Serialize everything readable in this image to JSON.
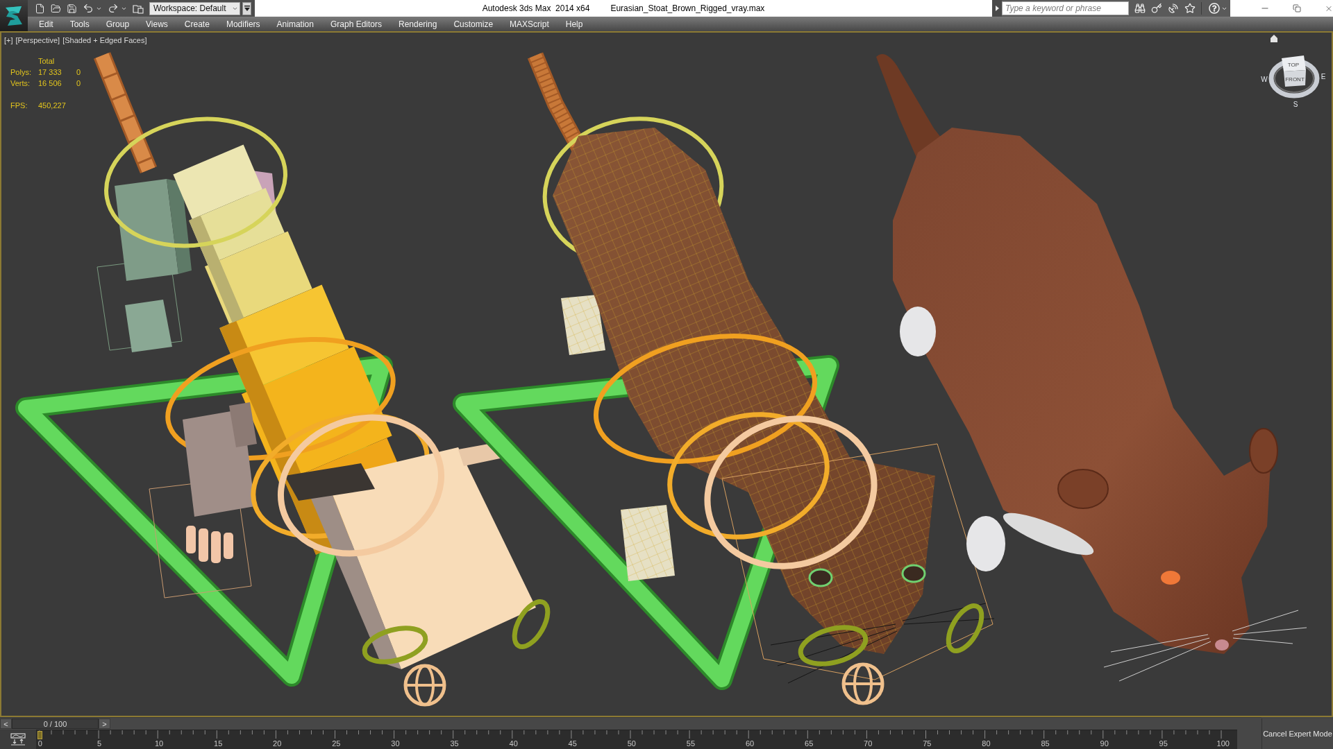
{
  "title_bar": {
    "workspace": "Workspace: Default",
    "title": "Autodesk 3ds Max  2014 x64",
    "file_name": "Eurasian_Stoat_Brown_Rigged_vray.max",
    "search": {
      "placeholder": "Type a keyword or phrase"
    }
  },
  "menu_bar": [
    "Edit",
    "Tools",
    "Group",
    "Views",
    "Create",
    "Modifiers",
    "Animation",
    "Graph Editors",
    "Rendering",
    "Customize",
    "MAXScript",
    "Help"
  ],
  "viewport": {
    "labels": [
      "[+]",
      "[Perspective]",
      "[Shaded + Edged Faces]"
    ],
    "stats": {
      "header": "Total",
      "rows": [
        {
          "label": "Polys:",
          "total": "17 333",
          "column_3": "0"
        },
        {
          "label": "Verts:",
          "total": "16 506",
          "column_3": "0"
        }
      ],
      "fps_label": "FPS:",
      "fps_value": "450,227"
    },
    "view_cube": {
      "top": "TOP",
      "front": "FRONT",
      "compass": {
        "west": "W",
        "east": "E",
        "south": "S"
      }
    }
  },
  "time_slider": {
    "previous": "<",
    "reading": "0 / 100",
    "next": ">",
    "level": 0
  },
  "track_bar": {
    "ticks": [
      "0",
      "5",
      "10",
      "15",
      "20",
      "25",
      "30",
      "35",
      "40",
      "45",
      "50",
      "55",
      "60",
      "65",
      "70",
      "75",
      "80",
      "85",
      "90",
      "95",
      "100"
    ]
  },
  "expert_mode_button": "Cancel Expert Mode"
}
